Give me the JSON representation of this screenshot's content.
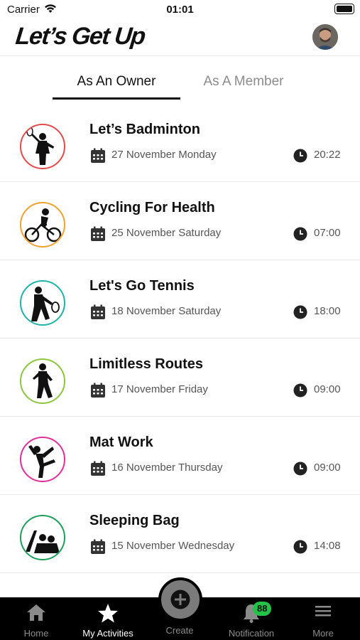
{
  "status_bar": {
    "carrier": "Carrier",
    "time": "01:01"
  },
  "header": {
    "logo": "Let’s Get Up"
  },
  "tabs": [
    {
      "label": "As An Owner",
      "active": true
    },
    {
      "label": "As A Member",
      "active": false
    }
  ],
  "activities": [
    {
      "title": "Let’s Badminton",
      "date": "27 November Monday",
      "time": "20:22",
      "ring_color": "#e34b4b",
      "icon": "badminton-icon"
    },
    {
      "title": "Cycling For Health",
      "date": "25 November Saturday",
      "time": "07:00",
      "ring_color": "#f0a22e",
      "icon": "cycling-icon"
    },
    {
      "title": "Let's Go Tennis",
      "date": "18 November Saturday",
      "time": "18:00",
      "ring_color": "#1fb3a8",
      "icon": "tennis-icon"
    },
    {
      "title": "Limitless Routes",
      "date": "17 November Friday",
      "time": "09:00",
      "ring_color": "#8cc63f",
      "icon": "running-icon"
    },
    {
      "title": "Mat Work",
      "date": "16 November Thursday",
      "time": "09:00",
      "ring_color": "#e0309a",
      "icon": "yoga-icon"
    },
    {
      "title": "Sleeping Bag",
      "date": "15 November Wednesday",
      "time": "14:08",
      "ring_color": "#1f9e5a",
      "icon": "camping-icon"
    }
  ],
  "tab_bar": {
    "home": "Home",
    "activities": "My Activities",
    "create": "Create",
    "notification": "Notification",
    "notification_badge": "88",
    "more": "More"
  }
}
